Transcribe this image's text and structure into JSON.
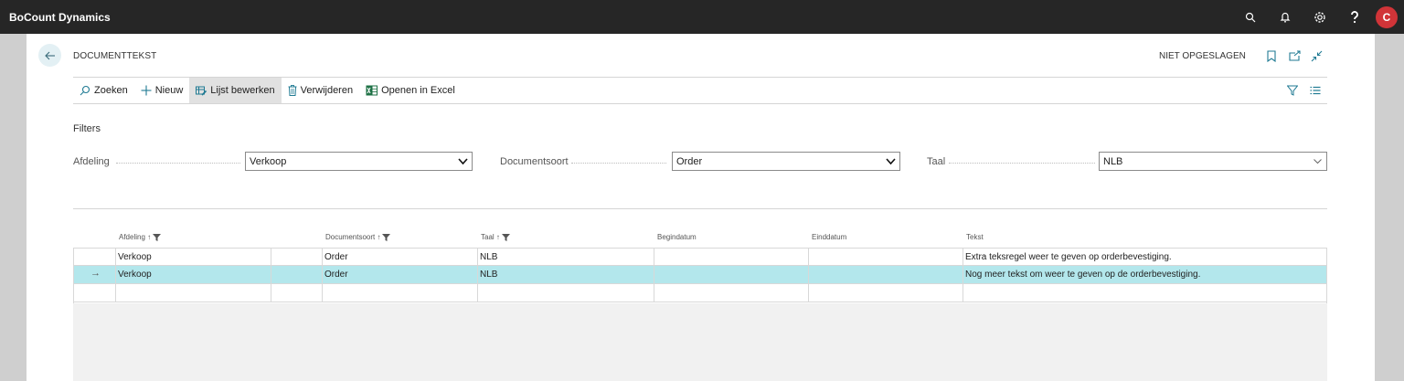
{
  "app": {
    "title": "BoCount Dynamics",
    "avatar_initial": "C"
  },
  "page": {
    "title": "DOCUMENTTEKST",
    "status": "NIET OPGESLAGEN"
  },
  "actions": [
    {
      "label": "Zoeken",
      "icon": "search-icon"
    },
    {
      "label": "Nieuw",
      "icon": "plus-icon"
    },
    {
      "label": "Lijst bewerken",
      "icon": "edit-list-icon"
    },
    {
      "label": "Verwijderen",
      "icon": "trash-icon"
    },
    {
      "label": "Openen in Excel",
      "icon": "excel-icon"
    }
  ],
  "filters": {
    "heading": "Filters",
    "afdeling": {
      "label": "Afdeling",
      "value": "Verkoop"
    },
    "documentsoort": {
      "label": "Documentsoort",
      "value": "Order"
    },
    "taal": {
      "label": "Taal",
      "value": "NLB"
    }
  },
  "table": {
    "columns": {
      "afdeling": "Afdeling ↑",
      "documentsoort": "Documentsoort ↑",
      "taal": "Taal ↑",
      "begindatum": "Begindatum",
      "einddatum": "Einddatum",
      "tekst": "Tekst"
    },
    "rows": [
      {
        "afdeling": "Verkoop",
        "documentsoort": "Order",
        "taal": "NLB",
        "begindatum": "",
        "einddatum": "",
        "tekst": "Extra teksregel weer te geven op orderbevestiging."
      },
      {
        "afdeling": "Verkoop",
        "documentsoort": "Order",
        "taal": "NLB",
        "begindatum": "",
        "einddatum": "",
        "tekst": "Nog meer tekst om weer te geven op de orderbevestiging.",
        "selected": true,
        "marker": "→"
      },
      {
        "afdeling": "",
        "documentsoort": "",
        "taal": "",
        "begindatum": "",
        "einddatum": "",
        "tekst": ""
      }
    ]
  },
  "colors": {
    "accent": "#1f7a93",
    "selected_row": "#b3e7ec",
    "topbar": "#262626",
    "avatar": "#d13438"
  }
}
